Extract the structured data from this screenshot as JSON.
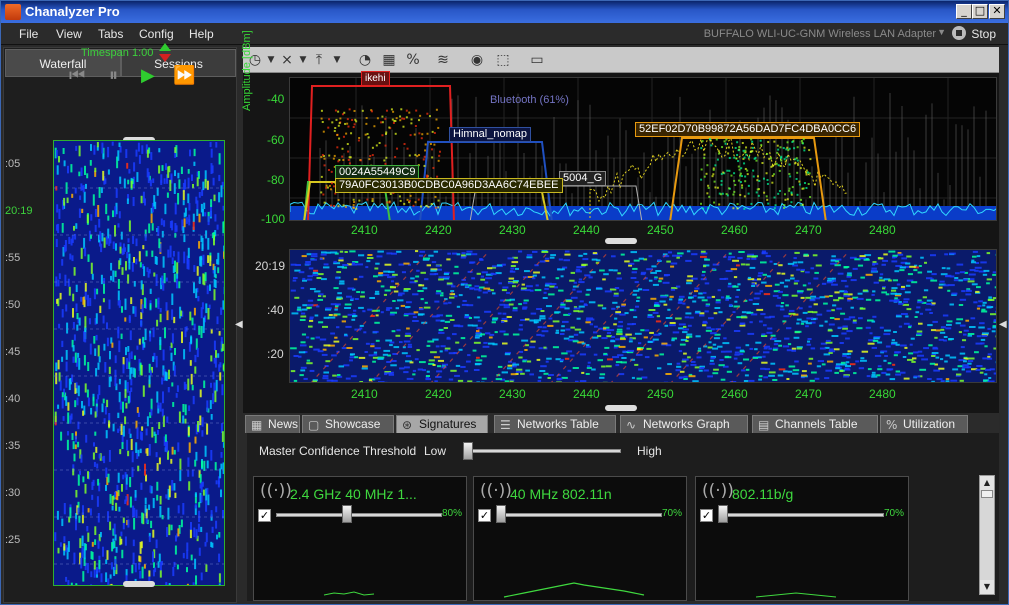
{
  "window": {
    "title": "Chanalyzer Pro",
    "buttons": [
      "_",
      "□",
      "✕"
    ]
  },
  "menu": {
    "items": [
      "File",
      "View",
      "Tabs",
      "Config",
      "Help"
    ],
    "adapter": "BUFFALO WLI-UC-GNM Wireless LAN Adapter",
    "stop_label": "Stop"
  },
  "left_panel": {
    "tabs": [
      "Waterfall",
      "Sessions"
    ],
    "timespan": "Timespan 1:00",
    "time_labels": [
      ":05",
      "20:19",
      ":55",
      ":50",
      ":45",
      ":40",
      ":35",
      ":30",
      ":25"
    ]
  },
  "spectrum": {
    "y_axis_label": "Amplitude [dBm]",
    "y_ticks": [
      "-40",
      "-60",
      "-80",
      "-100"
    ],
    "x_ticks": [
      "2410",
      "2420",
      "2430",
      "2440",
      "2450",
      "2460",
      "2470",
      "2480"
    ],
    "annotations": {
      "ikehi": "ikehi",
      "bluetooth": "Bluetooth (61%)",
      "himnal": "Himnal_nomap",
      "net52": "52EF02D70B99872A56DAD7FC4DBA0CC6",
      "net0024": "0024A55449C9",
      "net79": "79A0FC3013B0CDBC0A96D3AA6C74EBEE",
      "net5004": "5004_G"
    }
  },
  "waterfall": {
    "time_labels": [
      "20:19",
      ":40",
      ":20"
    ],
    "x_ticks": [
      "2410",
      "2420",
      "2430",
      "2440",
      "2450",
      "2460",
      "2470",
      "2480"
    ]
  },
  "bottom_tabs": [
    "News",
    "Showcase",
    "Signatures",
    "Networks Table",
    "Networks Graph",
    "Channels Table",
    "Utilization"
  ],
  "active_tab": "Signatures",
  "signatures": {
    "threshold_label": "Master Confidence Threshold",
    "low": "Low",
    "high": "High",
    "threshold_fraction": 0.0,
    "cards": [
      {
        "name": "2.4 GHz 40 MHz 1...",
        "confidence_pct": "80%",
        "confidence": 0.42,
        "checked": true
      },
      {
        "name": "40 MHz 802.11n",
        "confidence_pct": "70%",
        "confidence": 0.0,
        "checked": true
      },
      {
        "name": "802.11b/g",
        "confidence_pct": "70%",
        "confidence": 0.0,
        "checked": true
      }
    ]
  },
  "colors": {
    "accent_green": "#3fd93f",
    "red_up": "#d22020",
    "bg": "#1b1b1b"
  }
}
